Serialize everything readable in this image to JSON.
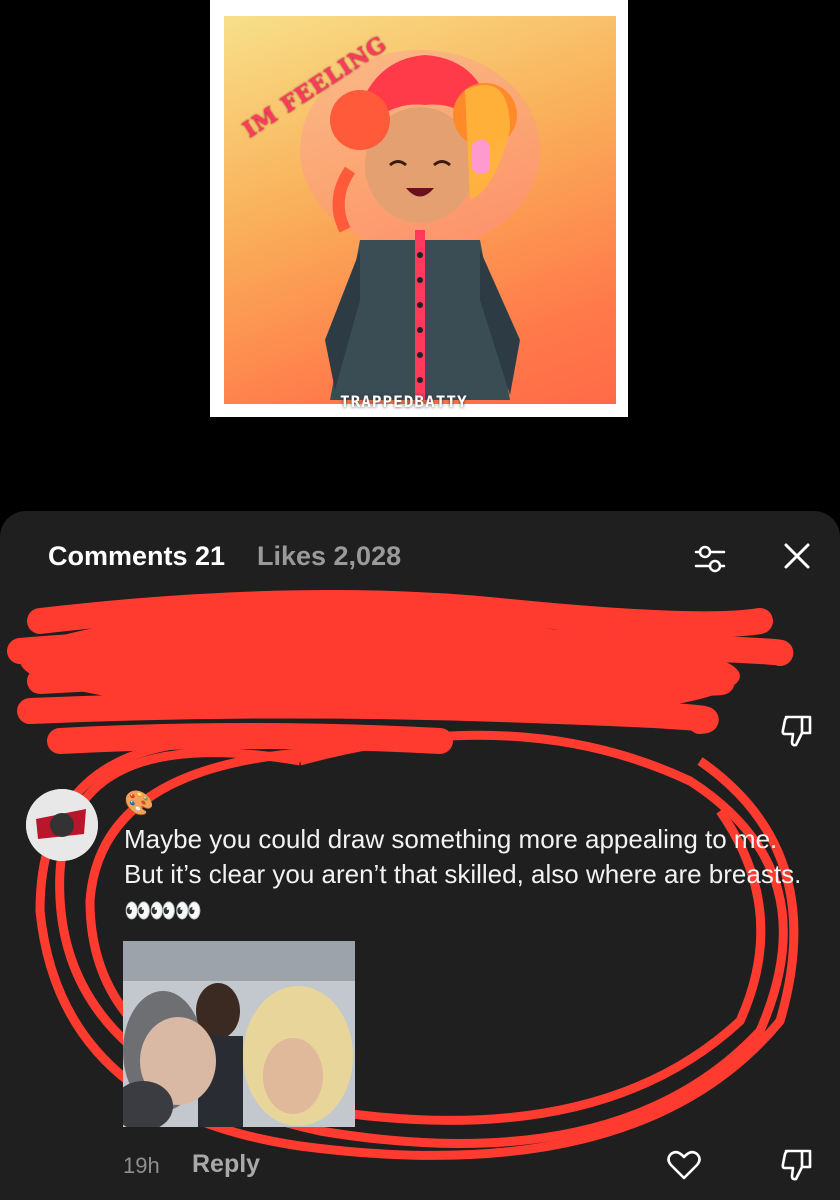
{
  "artwork": {
    "caption": "IM FEELING",
    "signature": "TRAPPEDBATTY"
  },
  "tabs": {
    "comments_label": "Comments 21",
    "likes_label": "Likes 2,028"
  },
  "icons": {
    "filter": "sliders-icon",
    "close": "close-icon",
    "like": "heart-icon",
    "dislike": "thumbs-down-icon"
  },
  "comment": {
    "username_emoji": "🎨",
    "text": "Maybe you could draw something more appealing to me. But it’s clear you aren’t that skilled, also where are breasts.",
    "emoji_suffix": "👀👀👀",
    "timestamp": "19h",
    "reply_label": "Reply"
  },
  "colors": {
    "sheet_bg": "#1f1f1f",
    "annotation_red": "#ff3b30",
    "muted_text": "#8f8f8f"
  }
}
